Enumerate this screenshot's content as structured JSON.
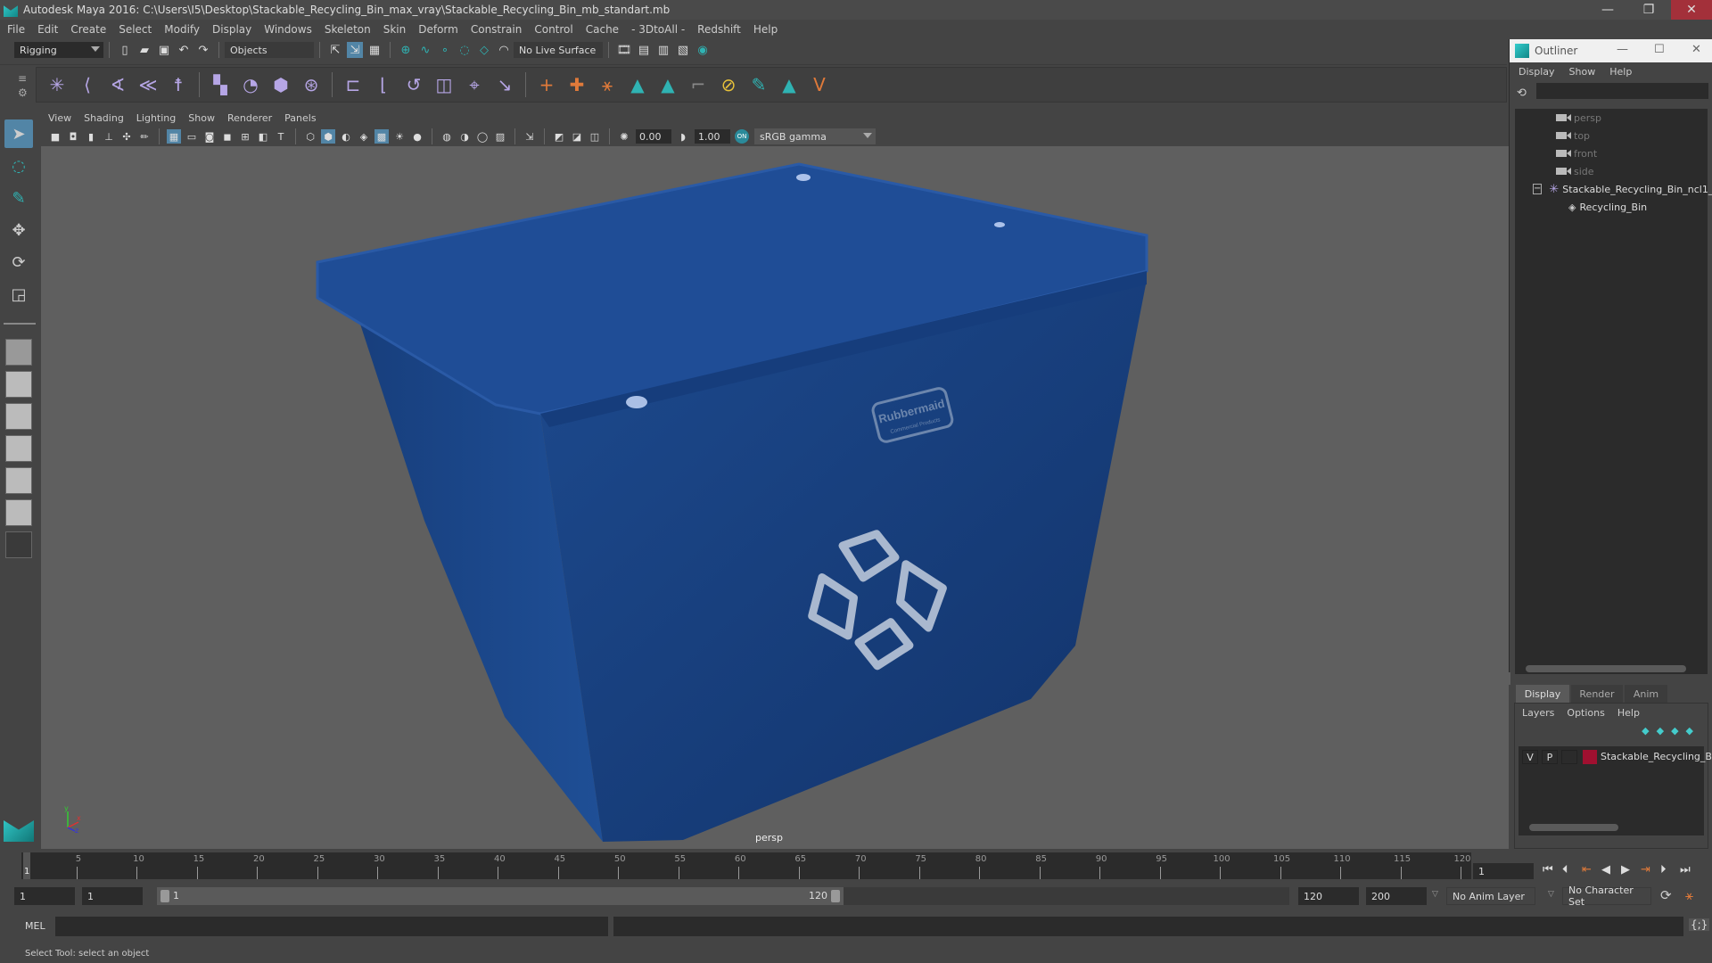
{
  "window": {
    "title": "Autodesk Maya 2016: C:\\Users\\I5\\Desktop\\Stackable_Recycling_Bin_max_vray\\Stackable_Recycling_Bin_mb_standart.mb",
    "minimize": "—",
    "restore": "❐",
    "close": "✕"
  },
  "menubar": [
    "File",
    "Edit",
    "Create",
    "Select",
    "Modify",
    "Display",
    "Windows",
    "Skeleton",
    "Skin",
    "Deform",
    "Constrain",
    "Control",
    "Cache",
    "- 3DtoAll -",
    "Redshift",
    "Help"
  ],
  "statusline": {
    "mode": "Rigging",
    "selection_mode": "Objects",
    "live_surface": "No Live Surface"
  },
  "panel": {
    "menu": [
      "View",
      "Shading",
      "Lighting",
      "Show",
      "Renderer",
      "Panels"
    ],
    "exposure": "0.00",
    "gamma": "1.00",
    "color_space": "sRGB gamma",
    "camera_label": "persp"
  },
  "viewport": {
    "object": "Recycling_Bin",
    "bin_color": "#1a3f7a",
    "brand_text": "Rubbermaid",
    "brand_subtext": "Commercial Products"
  },
  "outliner": {
    "title": "Outliner",
    "menu": [
      "Display",
      "Show",
      "Help"
    ],
    "cameras": [
      "persp",
      "top",
      "front",
      "side"
    ],
    "group": "Stackable_Recycling_Bin_ncl1_",
    "child": "Recycling_Bin"
  },
  "layers": {
    "tabs": [
      "Display",
      "Render",
      "Anim"
    ],
    "active_tab": "Display",
    "menu": [
      "Layers",
      "Options",
      "Help"
    ],
    "rows": [
      {
        "v": "V",
        "p": "P",
        "color": "#a01030",
        "name": "Stackable_Recycling_B"
      }
    ]
  },
  "timeline": {
    "ticks": [
      "5",
      "10",
      "15",
      "20",
      "25",
      "30",
      "35",
      "40",
      "45",
      "50",
      "55",
      "60",
      "65",
      "70",
      "75",
      "80",
      "85",
      "90",
      "95",
      "100",
      "105",
      "110",
      "115",
      "120"
    ],
    "start_marker": "1",
    "current_frame": "1",
    "range_start": "1",
    "range_inner_start": "1",
    "slider_start": "1",
    "slider_end": "120",
    "anim_end": "120",
    "playback_end": "200",
    "anim_layer": "No Anim Layer",
    "character_set": "No Character Set"
  },
  "commandline": {
    "label": "MEL"
  },
  "helpline": {
    "text": "Select Tool: select an object"
  }
}
